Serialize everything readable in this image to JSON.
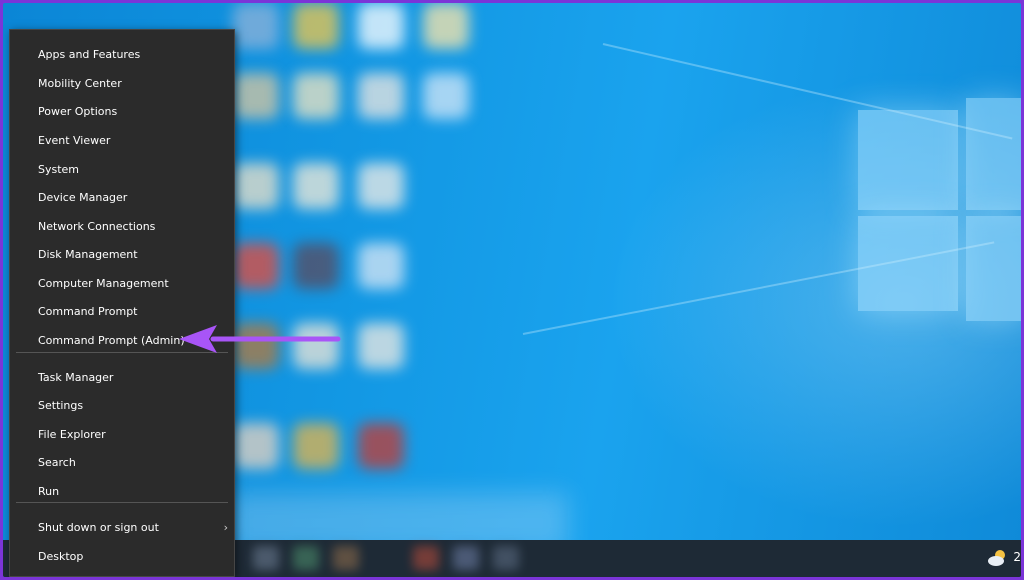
{
  "menu": {
    "groups": [
      [
        {
          "label": "Apps and Features"
        },
        {
          "label": "Mobility Center"
        },
        {
          "label": "Power Options"
        },
        {
          "label": "Event Viewer"
        },
        {
          "label": "System"
        },
        {
          "label": "Device Manager"
        },
        {
          "label": "Network Connections"
        },
        {
          "label": "Disk Management"
        },
        {
          "label": "Computer Management"
        },
        {
          "label": "Command Prompt"
        },
        {
          "label": "Command Prompt (Admin)"
        }
      ],
      [
        {
          "label": "Task Manager"
        },
        {
          "label": "Settings"
        },
        {
          "label": "File Explorer"
        },
        {
          "label": "Search"
        },
        {
          "label": "Run"
        }
      ],
      [
        {
          "label": "Shut down or sign out",
          "submenu": true
        },
        {
          "label": "Desktop"
        }
      ]
    ]
  },
  "tray": {
    "text": "2"
  },
  "colors": {
    "frame": "#7b35d8",
    "arrow": "#a855f7",
    "menu_bg": "#2b2b2b"
  },
  "icons": {
    "arrow": "annotation-arrow-icon",
    "weather": "partly-cloudy-weather-icon",
    "submenu": "chevron-right-icon"
  }
}
